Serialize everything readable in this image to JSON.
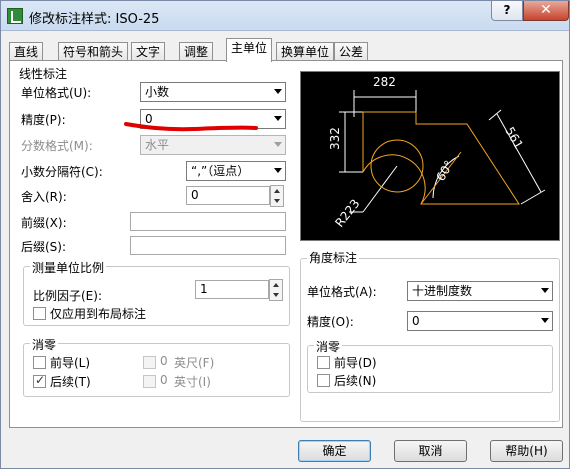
{
  "window": {
    "title": "修改标注样式: ISO-25",
    "help_glyph": "?",
    "close_glyph": "✕"
  },
  "tabs": [
    "直线",
    "符号和箭头",
    "文字",
    "调整",
    "主单位",
    "换算单位",
    "公差"
  ],
  "linear": {
    "section_title": "线性标注",
    "unit_format_label": "单位格式(U):",
    "unit_format_value": "小数",
    "precision_label": "精度(P):",
    "precision_value": "0",
    "fraction_format_label": "分数格式(M):",
    "fraction_format_value": "水平",
    "decimal_sep_label": "小数分隔符(C):",
    "decimal_sep_value": "“,”（逗点）",
    "roundoff_label": "舍入(R):",
    "roundoff_value": "0",
    "prefix_label": "前缀(X):",
    "prefix_value": "",
    "suffix_label": "后缀(S):",
    "suffix_value": ""
  },
  "scale": {
    "title": "测量单位比例",
    "factor_label": "比例因子(E):",
    "factor_value": "1",
    "layout_only_label": "仅应用到布局标注"
  },
  "zero_linear": {
    "title": "消零",
    "leading_label": "前导(L)",
    "trailing_label": "后续(T)",
    "feet_label": "英尺(F)",
    "inches_label": "英寸(I)",
    "feet_value": "0",
    "inches_value": "0",
    "leading_checked": false,
    "trailing_checked": true
  },
  "preview": {
    "dim_top": "282",
    "dim_left": "332",
    "dim_right": "561",
    "dim_radius": "R223",
    "dim_angle": "60°"
  },
  "angular": {
    "title": "角度标注",
    "unit_format_label": "单位格式(A):",
    "unit_format_value": "十进制度数",
    "precision_label": "精度(O):",
    "precision_value": "0"
  },
  "zero_angular": {
    "title": "消零",
    "leading_label": "前导(D)",
    "trailing_label": "后续(N)"
  },
  "buttons": {
    "ok": "确定",
    "cancel": "取消",
    "help": "帮助(H)"
  },
  "colors": {
    "preview_bg": "#000000",
    "preview_lines": "#ffffff",
    "preview_geometry": "#f5a623",
    "annotation": "#e00000"
  }
}
